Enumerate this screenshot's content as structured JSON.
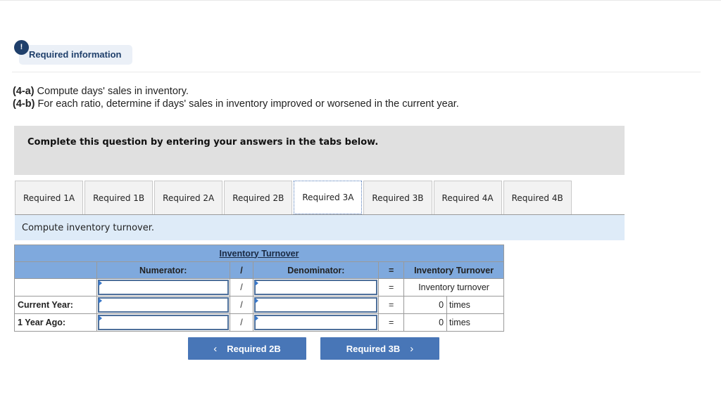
{
  "header": {
    "alert_icon": "!",
    "required_info_label": "Required information"
  },
  "instructions": {
    "part_a_tag": "(4-a)",
    "part_a_text": " Compute days' sales in inventory.",
    "part_b_tag": "(4-b)",
    "part_b_text": " For each ratio, determine if days' sales in inventory improved or worsened in the current year."
  },
  "prompt": "Complete this question by entering your answers in the tabs below.",
  "tabs": [
    {
      "label": "Required 1A",
      "active": false
    },
    {
      "label": "Required 1B",
      "active": false
    },
    {
      "label": "Required 2A",
      "active": false
    },
    {
      "label": "Required 2B",
      "active": false
    },
    {
      "label": "Required 3A",
      "active": true
    },
    {
      "label": "Required 3B",
      "active": false
    },
    {
      "label": "Required 4A",
      "active": false
    },
    {
      "label": "Required 4B",
      "active": false
    }
  ],
  "subtitle": "Compute inventory turnover.",
  "table": {
    "title": "Inventory Turnover",
    "headers": {
      "label": "",
      "numerator": "Numerator:",
      "divide": "/",
      "denominator": "Denominator:",
      "equals": "=",
      "result": "Inventory Turnover"
    },
    "rows": [
      {
        "label": "",
        "numerator": "",
        "divide": "/",
        "denominator": "",
        "equals": "=",
        "result_text": "Inventory turnover"
      },
      {
        "label": "Current Year:",
        "numerator": "",
        "divide": "/",
        "denominator": "",
        "equals": "=",
        "value": "0",
        "unit": "times"
      },
      {
        "label": "1 Year Ago:",
        "numerator": "",
        "divide": "/",
        "denominator": "",
        "equals": "=",
        "value": "0",
        "unit": "times"
      }
    ]
  },
  "nav": {
    "prev_label": "Required 2B",
    "prev_icon": "‹",
    "next_label": "Required 3B",
    "next_icon": "›"
  },
  "colors": {
    "accent": "#4876b7",
    "table_header": "#7fa9dd",
    "subtitle_bg": "#deebf8",
    "badge_bg": "#ebf0f7",
    "badge_text": "#1f3f6b"
  }
}
